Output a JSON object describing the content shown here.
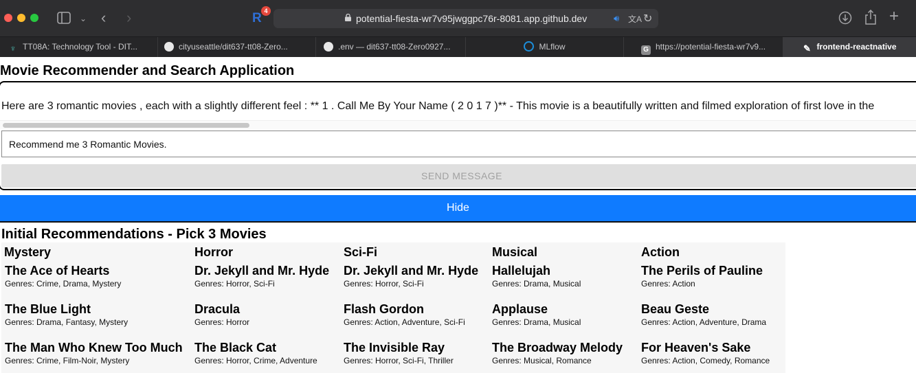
{
  "browser": {
    "url": "potential-fiesta-wr7v95jwggpc76r-8081.app.github.dev",
    "extension_badge": "4",
    "extension_label": "R",
    "tabs": [
      {
        "label": "TT08A: Technology Tool - DIT...",
        "icon": "bot-icon"
      },
      {
        "label": "cityuseattle/dit637-tt08-Zero...",
        "icon": "github-icon"
      },
      {
        "label": ".env — dit637-tt08-Zero0927...",
        "icon": "github-icon"
      },
      {
        "label": "MLflow",
        "icon": "mlflow-icon"
      },
      {
        "label": "https://potential-fiesta-wr7v9...",
        "icon": "g-icon"
      },
      {
        "label": "frontend-reactnative",
        "icon": "react-icon"
      }
    ]
  },
  "app": {
    "title": "Movie Recommender and Search Application",
    "response_text": "Here are 3 romantic movies , each with a slightly different feel : ** 1 . Call Me By Your Name ( 2 0 1 7 )** - This movie is a beautifully written and filmed exploration of first love in the",
    "input_value": "Recommend me 3 Romantic Movies.",
    "send_label": "SEND MESSAGE",
    "hide_label": "Hide"
  },
  "recommendations": {
    "title": "Initial Recommendations - Pick 3 Movies",
    "columns": [
      {
        "genre": "Mystery",
        "movies": [
          {
            "title": "The Ace of Hearts",
            "genres": "Genres: Crime, Drama, Mystery"
          },
          {
            "title": "The Blue Light",
            "genres": "Genres: Drama, Fantasy, Mystery"
          },
          {
            "title": "The Man Who Knew Too Much",
            "genres": "Genres: Crime, Film-Noir, Mystery"
          }
        ]
      },
      {
        "genre": "Horror",
        "movies": [
          {
            "title": "Dr. Jekyll and Mr. Hyde",
            "genres": "Genres: Horror, Sci-Fi"
          },
          {
            "title": "Dracula",
            "genres": "Genres: Horror"
          },
          {
            "title": "The Black Cat",
            "genres": "Genres: Horror, Crime, Adventure"
          }
        ]
      },
      {
        "genre": "Sci-Fi",
        "movies": [
          {
            "title": "Dr. Jekyll and Mr. Hyde",
            "genres": "Genres: Horror, Sci-Fi"
          },
          {
            "title": "Flash Gordon",
            "genres": "Genres: Action, Adventure, Sci-Fi"
          },
          {
            "title": "The Invisible Ray",
            "genres": "Genres: Horror, Sci-Fi, Thriller"
          }
        ]
      },
      {
        "genre": "Musical",
        "movies": [
          {
            "title": "Hallelujah",
            "genres": "Genres: Drama, Musical"
          },
          {
            "title": "Applause",
            "genres": "Genres: Drama, Musical"
          },
          {
            "title": "The Broadway Melody",
            "genres": "Genres: Musical, Romance"
          }
        ]
      },
      {
        "genre": "Action",
        "movies": [
          {
            "title": "The Perils of Pauline",
            "genres": "Genres: Action"
          },
          {
            "title": "Beau Geste",
            "genres": "Genres: Action, Adventure, Drama"
          },
          {
            "title": "For Heaven's Sake",
            "genres": "Genres: Action, Comedy, Romance"
          }
        ]
      }
    ]
  },
  "colors": {
    "chrome_bg": "#2e2e30",
    "tab_bg": "#262628",
    "hide_button": "#0f7bff",
    "grid_bg": "#f6f6f6"
  }
}
